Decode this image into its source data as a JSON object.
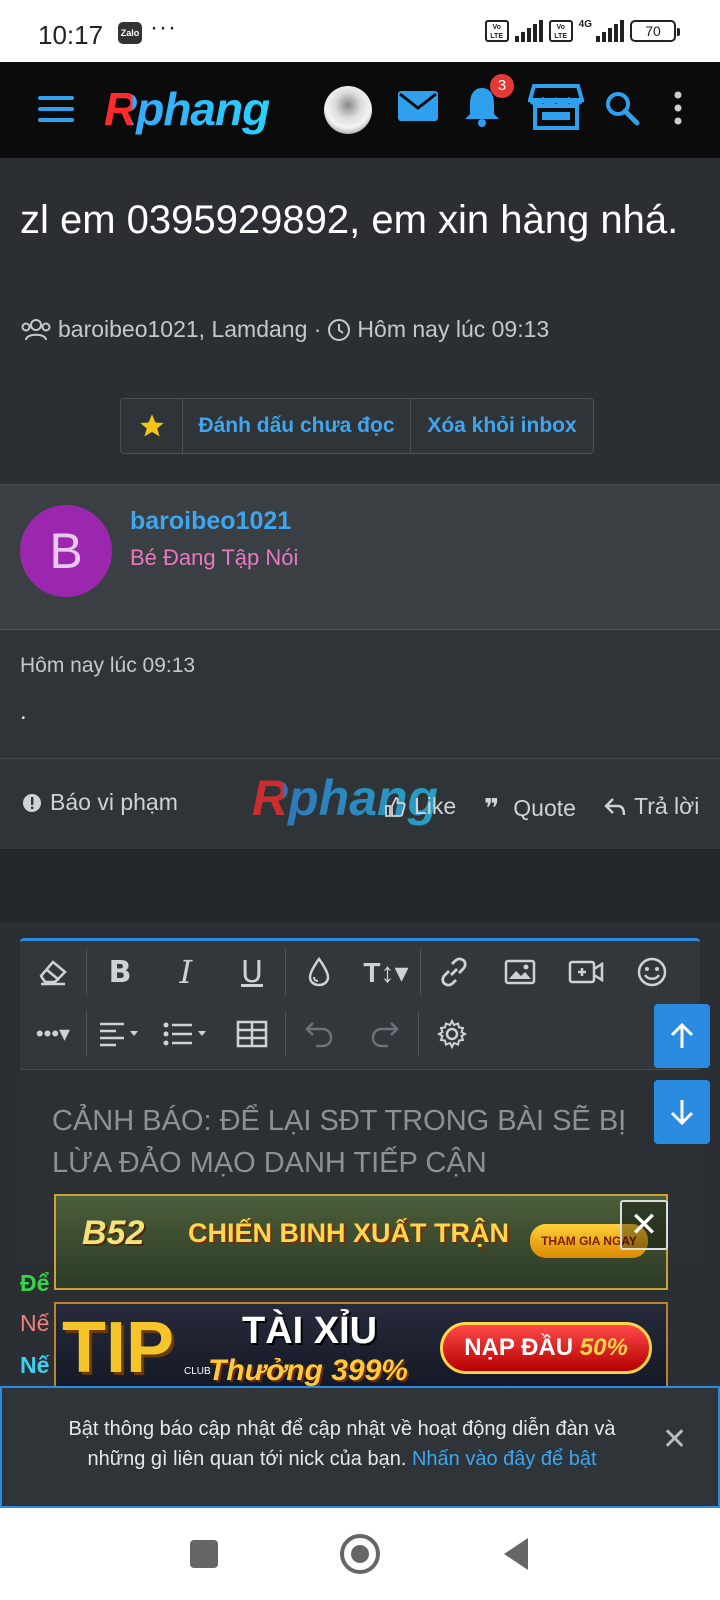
{
  "status_bar": {
    "time": "10:17",
    "zalo": "Zalo",
    "more": "···",
    "volte": "Vo LTE",
    "net": "4G",
    "battery": "70"
  },
  "header": {
    "logo": "Rphang",
    "notification_count": "3",
    "accent": "#2ea0ee"
  },
  "thread": {
    "title": "zl em 0395929892, em xin hàng nhá.",
    "participants": "baroibeo1021, Lamdang ·",
    "time": "Hôm nay lúc 09:13",
    "buttons": {
      "mark_unread": "Đánh dấu chưa đọc",
      "remove_inbox": "Xóa khỏi inbox"
    }
  },
  "message": {
    "avatar_letter": "B",
    "username": "baroibeo1021",
    "rank": "Bé Đang Tập Nói",
    "date": "Hôm nay lúc 09:13",
    "body": ".",
    "actions": {
      "report": "Báo vi phạm",
      "like": "Like",
      "quote": "Quote",
      "reply": "Trả lời"
    },
    "watermark": "Rphang"
  },
  "editor": {
    "placeholder": "CẢNH BÁO: ĐỂ LẠI SĐT TRONG BÀI SẼ BỊ LỪA ĐẢO MẠO DANH TIẾP CẬN",
    "toolbar_row1": [
      "eraser-icon",
      "bold-icon",
      "italic-icon",
      "underline-icon",
      "color-drop-icon",
      "font-size-icon",
      "link-icon",
      "image-icon",
      "video-icon",
      "smiley-icon"
    ],
    "toolbar_row2": [
      "more-icon",
      "align-icon",
      "list-icon",
      "table-icon",
      "undo-icon",
      "redo-icon",
      "settings-icon"
    ]
  },
  "peek_text": {
    "line1": "Để",
    "line2": "Nế",
    "line3": "Nế"
  },
  "ads": {
    "ad1_brand": "B52",
    "ad1_title": "CHIẾN BINH XUẤT TRẬN",
    "ad1_button": "THAM GIA NGAY",
    "ad2_brand": "TIP",
    "ad2_sub": "CLUB",
    "ad2_title": "TÀI XỈU",
    "ad2_bonus": "Thưởng 399%",
    "ad2_deposit": "NẠP ĐẦU",
    "ad2_percent": "50%"
  },
  "notice": {
    "text": "Bật thông báo cập nhật để cập nhật về hoạt động diễn đàn và những gì liên quan tới nick của bạn.",
    "link": "Nhấn vào đây để bật"
  }
}
